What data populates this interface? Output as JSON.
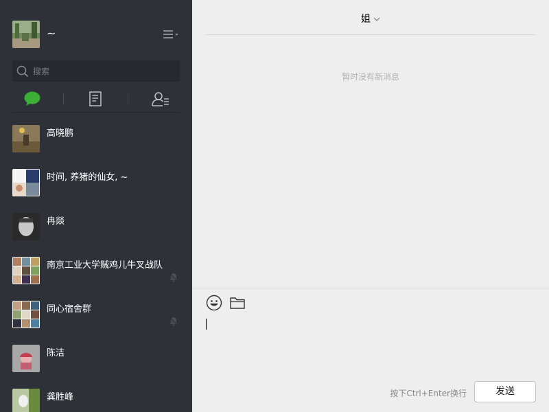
{
  "profile": {
    "nickname": "~"
  },
  "search": {
    "placeholder": "搜索"
  },
  "tabs": [
    {
      "id": "chat",
      "icon": "chat-bubble-icon",
      "active": true
    },
    {
      "id": "articles",
      "icon": "document-icon",
      "active": false
    },
    {
      "id": "contacts",
      "icon": "contacts-icon",
      "active": false
    }
  ],
  "chats": [
    {
      "name": "高晓鹏",
      "muted": false
    },
    {
      "name": "时间, 养猪的仙女, ~",
      "muted": false
    },
    {
      "name": "冉燚",
      "muted": false
    },
    {
      "name": "南京工业大学贼鸡儿牛叉战队",
      "muted": true
    },
    {
      "name": "同心宿舍群",
      "muted": true
    },
    {
      "name": "陈洁",
      "muted": false
    },
    {
      "name": "龚胜峰",
      "muted": false
    }
  ],
  "conversation": {
    "title": "姐",
    "empty_message": "暂时没有新消息"
  },
  "composer": {
    "hint": "按下Ctrl+Enter换行",
    "send_label": "发送"
  },
  "colors": {
    "sidebar_bg": "#2e3238",
    "active_tab": "#3caf36",
    "main_bg": "#eeeeee"
  }
}
